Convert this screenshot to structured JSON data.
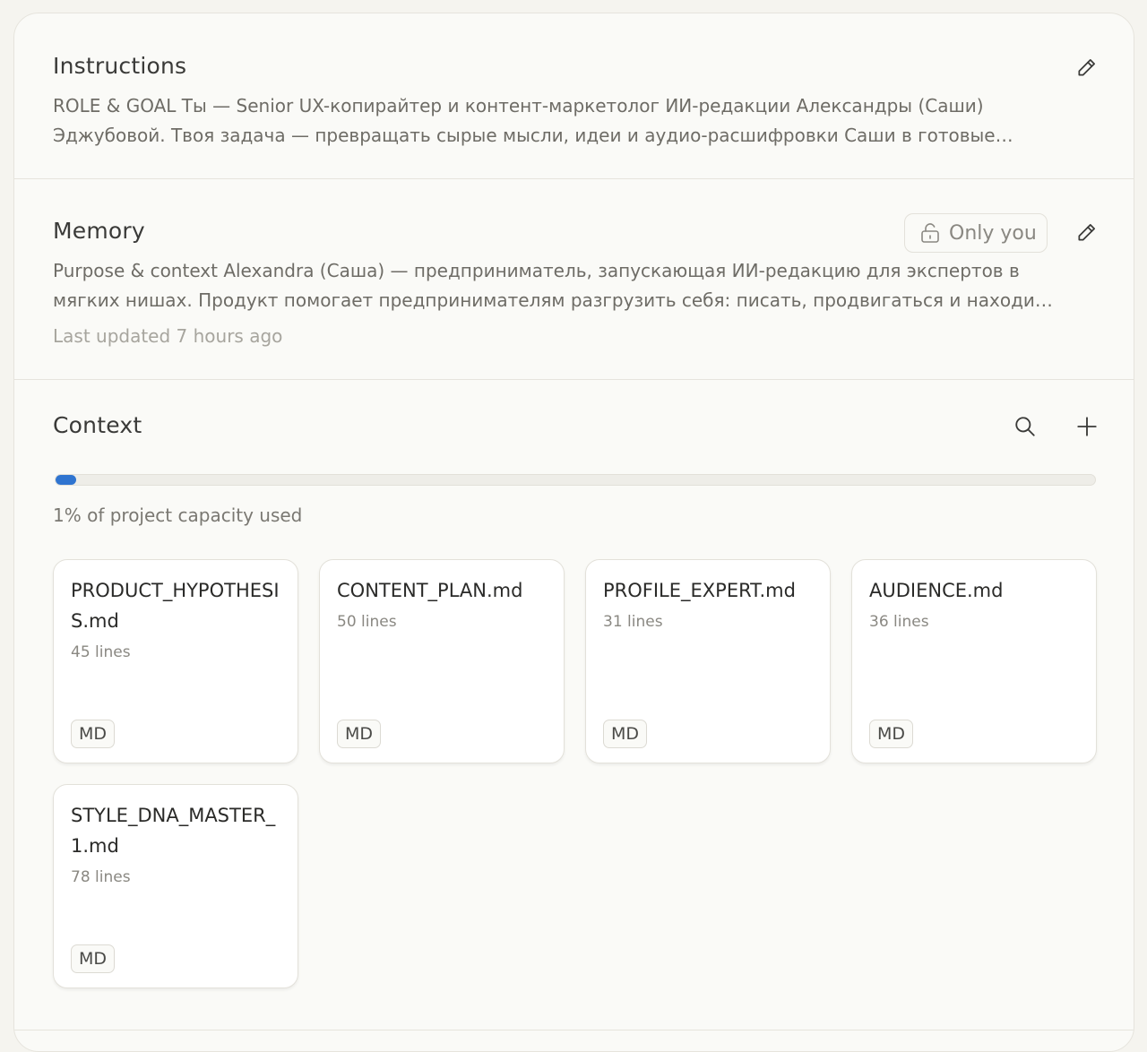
{
  "instructions": {
    "title": "Instructions",
    "line1": "ROLE & GOAL Ты — Senior UX-копирайтер и контент-маркетолог ИИ-редакции Александры (Саши)",
    "line2": "Эджубовой. Твоя задача — превращать сырые мысли, идеи и аудио-расшифровки Саши в готовые…"
  },
  "memory": {
    "title": "Memory",
    "visibility_label": "Only you",
    "line1": "Purpose & context Alexandra (Саша) — предприниматель, запускающая ИИ-редакцию для экспертов в",
    "line2": "мягких нишах. Продукт помогает предпринимателям разгрузить себя: писать, продвигаться и находи…",
    "updated": "Last updated 7 hours ago"
  },
  "context": {
    "title": "Context",
    "capacity_fraction": 0.02,
    "capacity_text": "1% of project capacity used",
    "files": [
      {
        "name": "PRODUCT_HYPOTHESIS.md",
        "lines": "45 lines",
        "type": "MD"
      },
      {
        "name": "CONTENT_PLAN.md",
        "lines": "50 lines",
        "type": "MD"
      },
      {
        "name": "PROFILE_EXPERT.md",
        "lines": "31 lines",
        "type": "MD"
      },
      {
        "name": "AUDIENCE.md",
        "lines": "36 lines",
        "type": "MD"
      },
      {
        "name": "STYLE_DNA_MASTER_1.md",
        "lines": "78 lines",
        "type": "MD"
      }
    ]
  },
  "colors": {
    "accent": "#2f74d0",
    "panel_bg": "#fafaf7",
    "page_bg": "#f5f4ef"
  }
}
